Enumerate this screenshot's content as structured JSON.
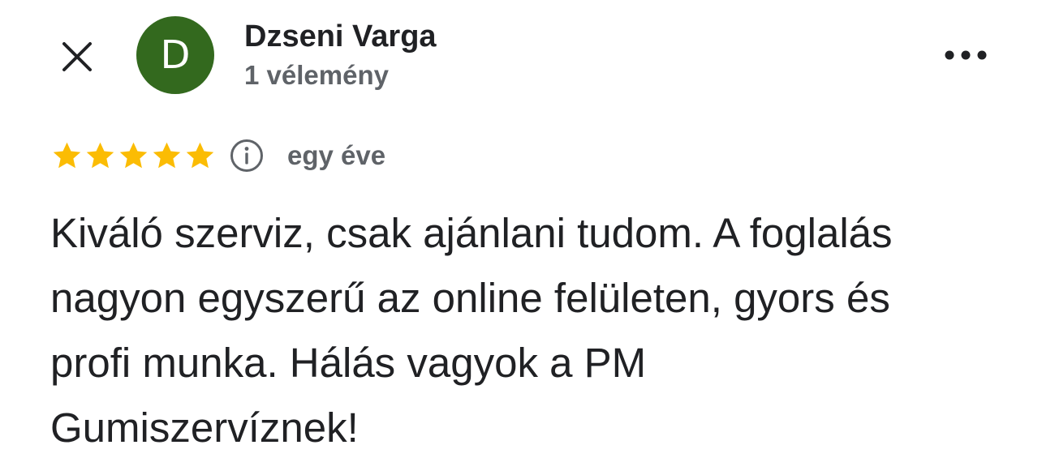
{
  "header": {
    "close_icon": "close-icon",
    "avatar_letter": "D",
    "avatar_color": "#33691e",
    "reviewer_name": "Dzseni Varga",
    "review_count": "1 vélemény",
    "more_icon": "more-horizontal-icon"
  },
  "review": {
    "rating": 5,
    "max_rating": 5,
    "star_color": "#fbbc04",
    "info_icon": "info-icon",
    "date": "egy éve",
    "text": "Kiváló szerviz, csak ajánlani tudom. A foglalás nagyon egyszerű az online felületen, gyors és profi munka. Hálás vagyok a PM Gumiszervíznek!"
  }
}
